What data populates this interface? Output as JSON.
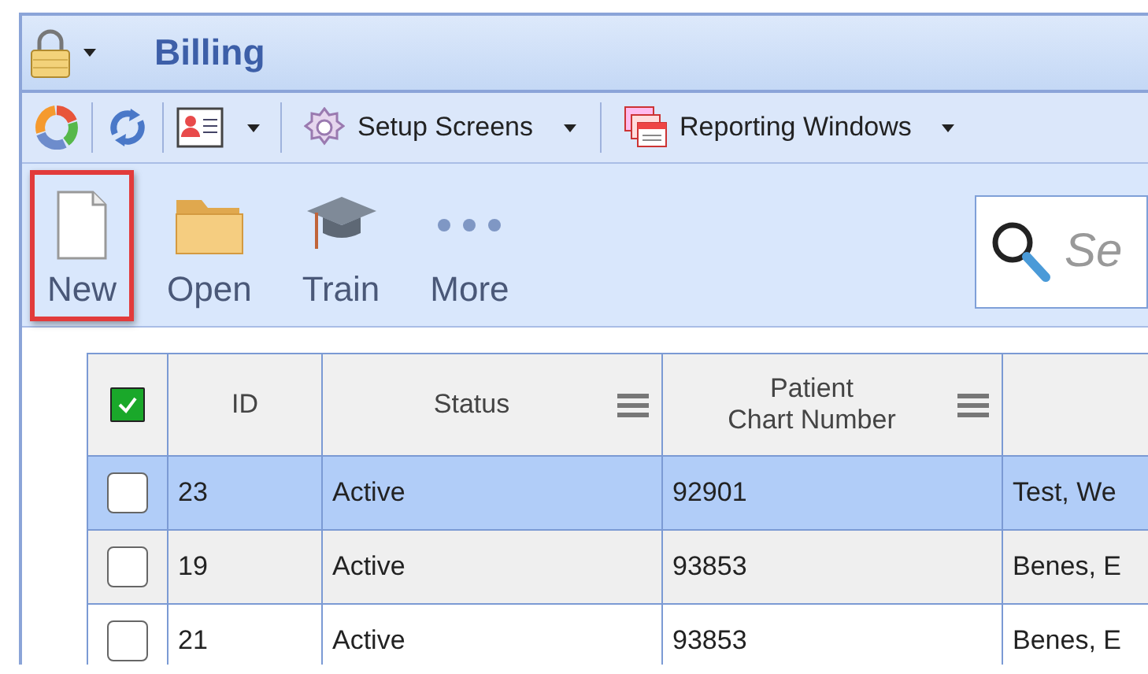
{
  "window": {
    "title": "Billing"
  },
  "toolbar": {
    "buttons": [
      {
        "label": "Setup Screens",
        "has_menu": true
      },
      {
        "label": "Reporting Windows",
        "has_menu": true
      }
    ]
  },
  "ribbon": {
    "actions": [
      {
        "label": "New",
        "highlighted": true
      },
      {
        "label": "Open",
        "highlighted": false
      },
      {
        "label": "Train",
        "highlighted": false
      },
      {
        "label": "More",
        "highlighted": false
      }
    ]
  },
  "search": {
    "placeholder": "Se"
  },
  "table": {
    "all_checked": true,
    "columns": [
      {
        "label": "ID",
        "menu": false
      },
      {
        "label": "Status",
        "menu": true
      },
      {
        "label": "Patient\nChart Number",
        "menu": true
      }
    ],
    "rows": [
      {
        "checked": false,
        "selected": true,
        "cells": [
          "23",
          "Active",
          "92901",
          "Test, We"
        ]
      },
      {
        "checked": false,
        "selected": false,
        "cells": [
          "19",
          "Active",
          "93853",
          "Benes, E"
        ]
      },
      {
        "checked": false,
        "selected": false,
        "cells": [
          "21",
          "Active",
          "93853",
          "Benes, E"
        ]
      }
    ]
  }
}
